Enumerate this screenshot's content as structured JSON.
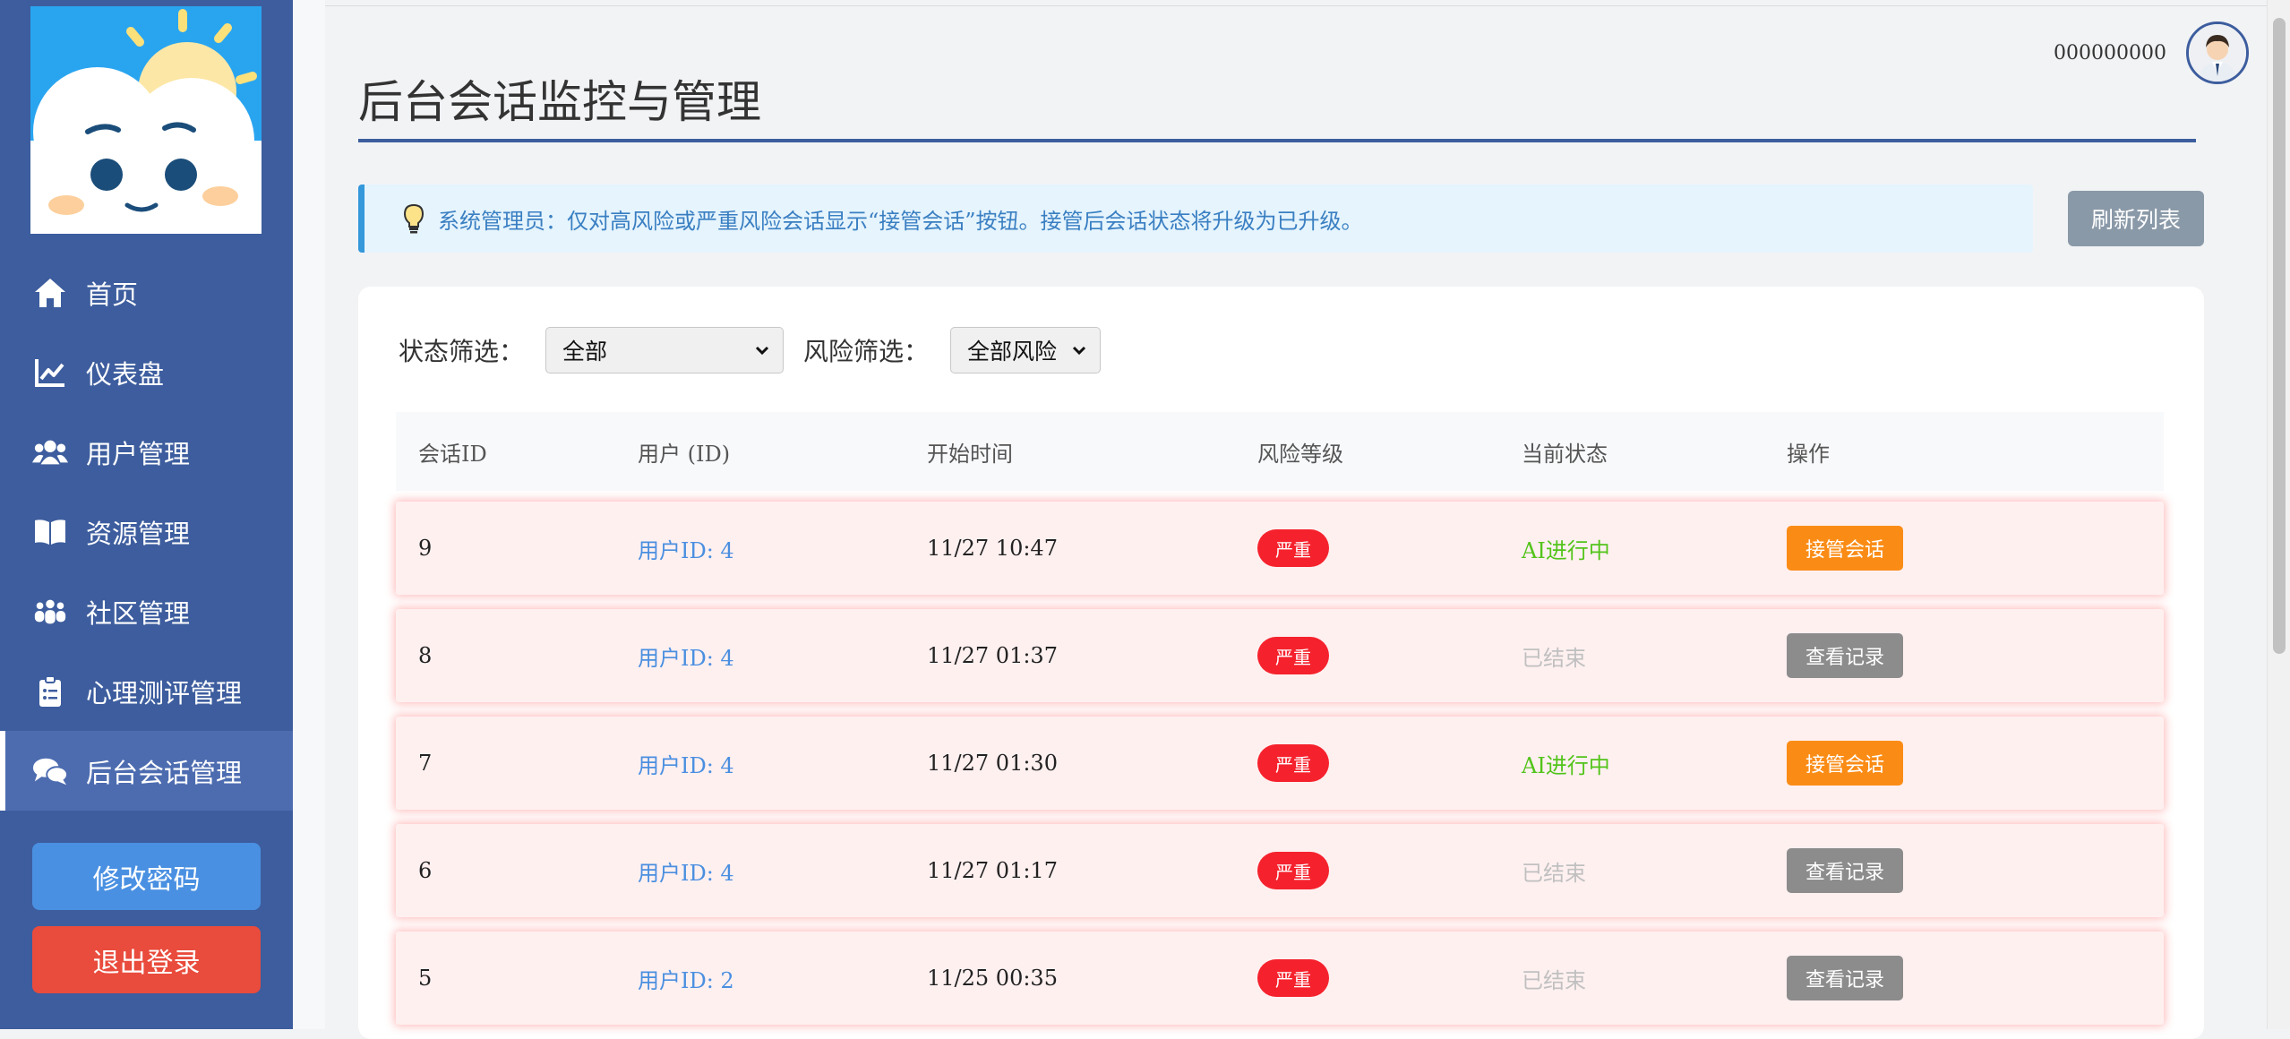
{
  "sidebar": {
    "items": [
      {
        "label": "首页",
        "icon": "home-icon"
      },
      {
        "label": "仪表盘",
        "icon": "chart-line-icon"
      },
      {
        "label": "用户管理",
        "icon": "users-icon"
      },
      {
        "label": "资源管理",
        "icon": "book-icon"
      },
      {
        "label": "社区管理",
        "icon": "community-icon"
      },
      {
        "label": "心理测评管理",
        "icon": "clipboard-icon"
      },
      {
        "label": "后台会话管理",
        "icon": "comments-icon",
        "active": true
      }
    ],
    "change_password": "修改密码",
    "logout": "退出登录"
  },
  "header": {
    "username": "000000000"
  },
  "page": {
    "title": "后台会话监控与管理",
    "notice": "系统管理员：仅对高风险或严重风险会话显示“接管会话”按钮。接管后会话状态将升级为已升级。",
    "refresh": "刷新列表"
  },
  "filters": {
    "status_label": "状态筛选：",
    "status_value": "全部",
    "risk_label": "风险筛选：",
    "risk_value": "全部风险"
  },
  "table": {
    "headers": [
      "会话ID",
      "用户 (ID)",
      "开始时间",
      "风险等级",
      "当前状态",
      "操作"
    ],
    "rows": [
      {
        "id": "9",
        "user": "用户ID: 4",
        "time": "11/27 10:47",
        "risk": "严重",
        "status": "AI进行中",
        "action": "接管会话"
      },
      {
        "id": "8",
        "user": "用户ID: 4",
        "time": "11/27 01:37",
        "risk": "严重",
        "status": "已结束",
        "action": "查看记录"
      },
      {
        "id": "7",
        "user": "用户ID: 4",
        "time": "11/27 01:30",
        "risk": "严重",
        "status": "AI进行中",
        "action": "接管会话"
      },
      {
        "id": "6",
        "user": "用户ID: 4",
        "time": "11/27 01:17",
        "risk": "严重",
        "status": "已结束",
        "action": "查看记录"
      },
      {
        "id": "5",
        "user": "用户ID: 2",
        "time": "11/25 00:35",
        "risk": "严重",
        "status": "已结束",
        "action": "查看记录"
      }
    ]
  },
  "colors": {
    "sidebar_bg": "#3d5d9e",
    "accent": "#3d5d9e",
    "danger": "#f5222d",
    "take_over": "#fa8c16",
    "view": "#8c8c8c",
    "status_ai": "#52c41a"
  }
}
